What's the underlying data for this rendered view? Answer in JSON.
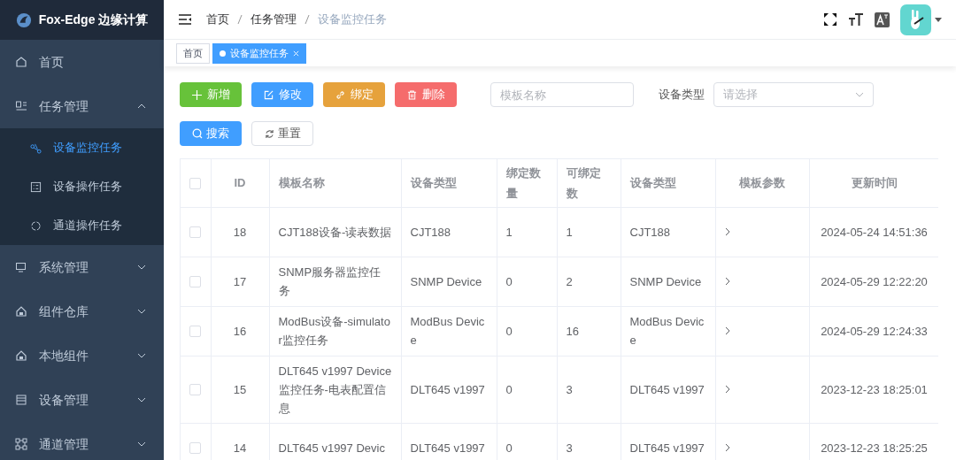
{
  "app": {
    "title": "Fox-Edge 边缘计算"
  },
  "sidebar": {
    "items": [
      {
        "label": "首页"
      },
      {
        "label": "任务管理",
        "expanded": true,
        "children": [
          {
            "label": "设备监控任务",
            "selected": true
          },
          {
            "label": "设备操作任务",
            "selected": false
          },
          {
            "label": "通道操作任务",
            "selected": false
          }
        ]
      },
      {
        "label": "系统管理",
        "expanded": false
      },
      {
        "label": "组件仓库",
        "expanded": false
      },
      {
        "label": "本地组件",
        "expanded": false
      },
      {
        "label": "设备管理",
        "expanded": false
      },
      {
        "label": "通道管理",
        "expanded": false
      }
    ]
  },
  "breadcrumb": [
    {
      "label": "首页",
      "current": false
    },
    {
      "label": "任务管理",
      "current": false
    },
    {
      "label": "设备监控任务",
      "current": true
    }
  ],
  "tabs": [
    {
      "label": "首页",
      "selected": false
    },
    {
      "label": "设备监控任务",
      "selected": true
    }
  ],
  "toolbar": {
    "buttons": [
      {
        "label": "新增",
        "color": "#67c23a"
      },
      {
        "label": "修改",
        "color": "#409eff"
      },
      {
        "label": "绑定",
        "color": "#e6a23c"
      },
      {
        "label": "删除",
        "color": "#f56c6c"
      }
    ],
    "name_field": {
      "placeholder": "模板名称"
    },
    "type_label": "设备类型",
    "type_select": {
      "placeholder": "请选择"
    },
    "search_button": "搜索",
    "reset_button": "重置"
  },
  "table": {
    "all_checked": false,
    "columns": [
      "ID",
      "模板名称",
      "设备类型",
      "绑定数量",
      "可绑定数",
      "设备类型",
      "模板参数",
      "更新时间"
    ],
    "rows": [
      {
        "checked": false,
        "cells": [
          "18",
          "CJT188设备-读表数据",
          "CJT188",
          "1",
          "1",
          "CJT188",
          "2024-05-24 14:51:36"
        ]
      },
      {
        "checked": false,
        "cells": [
          "17",
          "SNMP服务器监控任务",
          "SNMP Device",
          "0",
          "2",
          "SNMP Device",
          "2024-05-29 12:22:20"
        ]
      },
      {
        "checked": false,
        "cells": [
          "16",
          "ModBus设备-simulator监控任务",
          "ModBus Device",
          "0",
          "16",
          "ModBus Device",
          "2024-05-29 12:24:33"
        ]
      },
      {
        "checked": false,
        "cells": [
          "15",
          "DLT645 v1997 Device监控任务-电表配置信息",
          "DLT645 v1997",
          "0",
          "3",
          "DLT645 v1997",
          "2023-12-23 18:25:01"
        ]
      },
      {
        "checked": false,
        "cells": [
          "14",
          "DLT645 v1997 Devic",
          "DLT645 v1997",
          "0",
          "3",
          "DLT645 v1997",
          "2023-12-23 18:25:25"
        ]
      }
    ]
  }
}
